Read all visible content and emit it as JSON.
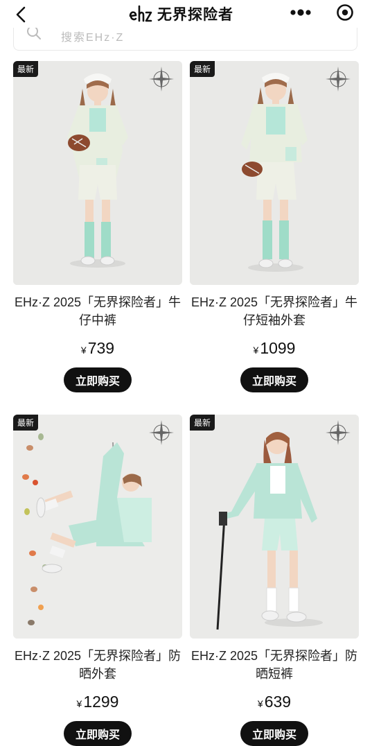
{
  "header": {
    "title": "无界探险者",
    "logo_text": "ehz",
    "icons": {
      "back": "chevron-left-icon",
      "more": "more-dots-icon",
      "close": "close-circle-icon"
    }
  },
  "search": {
    "placeholder": "搜索EHz·Z"
  },
  "products": [
    {
      "badge": "最新",
      "name": "EHz·Z 2025「无界探险者」牛仔中裤",
      "currency": "¥",
      "price": "739",
      "buy_label": "立即购买",
      "image": "model-denim-shorts"
    },
    {
      "badge": "最新",
      "name": "EHz·Z 2025「无界探险者」牛仔短袖外套",
      "currency": "¥",
      "price": "1099",
      "buy_label": "立即购买",
      "image": "model-denim-jacket"
    },
    {
      "badge": "最新",
      "name": "EHz·Z 2025「无界探险者」防晒外套",
      "currency": "¥",
      "price": "1299",
      "buy_label": "立即购买",
      "image": "model-sun-jacket-climbing"
    },
    {
      "badge": "最新",
      "name": "EHz·Z 2025「无界探险者」防晒短裤",
      "currency": "¥",
      "price": "639",
      "buy_label": "立即购买",
      "image": "model-sun-shorts-hiking"
    }
  ]
}
